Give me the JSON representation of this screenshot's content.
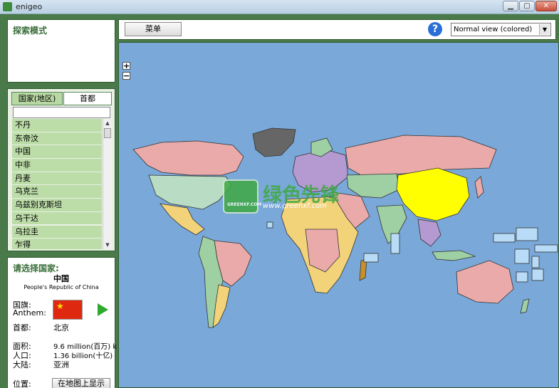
{
  "window": {
    "title": "enigeo",
    "min_label": "▁",
    "max_label": "▢",
    "close_label": "✕"
  },
  "explore": {
    "title": "探索模式"
  },
  "list_panel": {
    "tabs": [
      {
        "label": "国家(地区)"
      },
      {
        "label": "首都"
      }
    ],
    "search_value": "",
    "items": [
      "不丹",
      "东帝汶",
      "中国",
      "中非",
      "丹麦",
      "乌克兰",
      "乌兹别克斯坦",
      "乌干达",
      "乌拉圭",
      "乍得"
    ]
  },
  "info": {
    "prompt": "请选择国家:",
    "country": "中国",
    "country_en": "People's Republic of China",
    "flag_label": "国旗:",
    "anthem_label": "Anthem:",
    "capital_label": "首都:",
    "capital": "北京",
    "area_label": "面积:",
    "area": "9.6 million(百万) k",
    "population_label": "人口:",
    "population": "1.36 billion(十亿)",
    "continent_label": "大陆:",
    "continent": "亚洲",
    "location_label": "位置:",
    "show_on_map": "在地图上显示"
  },
  "toolbar": {
    "menu_label": "菜单",
    "help": "?",
    "view_mode": "Normal view (colored)"
  },
  "map": {
    "zoom_in": "+",
    "zoom_out": "−",
    "watermark_cn": "绿色先锋",
    "watermark_logo": "GREENXF.COM",
    "watermark_url": "www.greenxf.com",
    "highlight_color": "#ffff00",
    "ocean_color": "#7aa8d8"
  },
  "colors": {
    "accent": "#3a6e3a",
    "list_item": "#bcdca8",
    "frame": "#4a7a4a"
  }
}
